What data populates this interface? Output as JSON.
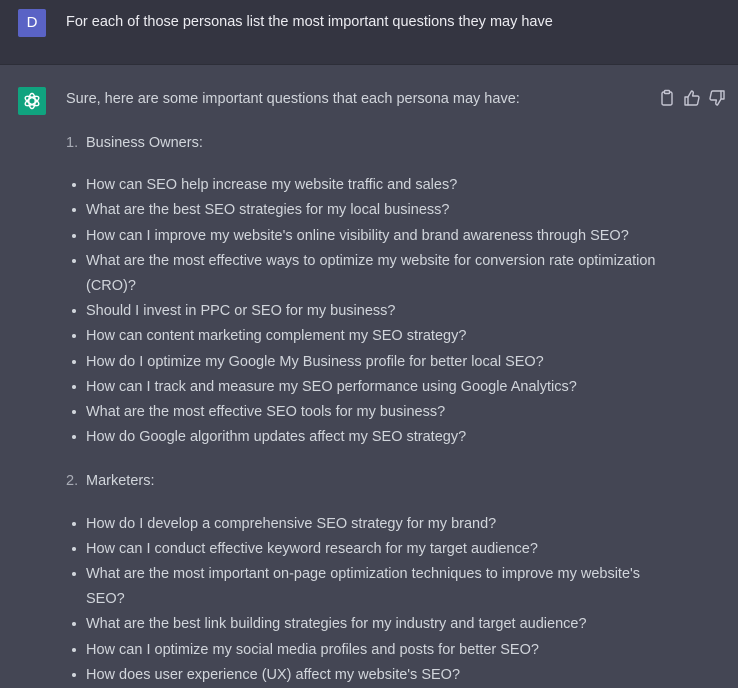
{
  "user_message": {
    "avatar_letter": "D",
    "text": "For each of those personas list the most important questions they may have"
  },
  "assistant_message": {
    "intro": "Sure, here are some important questions that each persona may have:",
    "sections": [
      {
        "number": "1.",
        "title": "Business Owners:",
        "questions": [
          "How can SEO help increase my website traffic and sales?",
          "What are the best SEO strategies for my local business?",
          "How can I improve my website's online visibility and brand awareness through SEO?",
          "What are the most effective ways to optimize my website for conversion rate optimization (CRO)?",
          "Should I invest in PPC or SEO for my business?",
          "How can content marketing complement my SEO strategy?",
          "How do I optimize my Google My Business profile for better local SEO?",
          "How can I track and measure my SEO performance using Google Analytics?",
          "What are the most effective SEO tools for my business?",
          "How do Google algorithm updates affect my SEO strategy?"
        ]
      },
      {
        "number": "2.",
        "title": "Marketers:",
        "questions": [
          "How do I develop a comprehensive SEO strategy for my brand?",
          "How can I conduct effective keyword research for my target audience?",
          "What are the most important on-page optimization techniques to improve my website's SEO?",
          "What are the best link building strategies for my industry and target audience?",
          "How can I optimize my social media profiles and posts for better SEO?",
          "How does user experience (UX) affect my website's SEO?"
        ]
      }
    ]
  },
  "icons": {
    "copy": "clipboard-icon",
    "like": "thumbs-up-icon",
    "dislike": "thumbs-down-icon",
    "assistant_logo": "openai-logo-icon"
  },
  "colors": {
    "user_bg": "#343541",
    "assistant_bg": "#444654",
    "user_avatar": "#5a63c5",
    "assistant_avatar": "#10a37f",
    "text": "#d1d5db"
  }
}
